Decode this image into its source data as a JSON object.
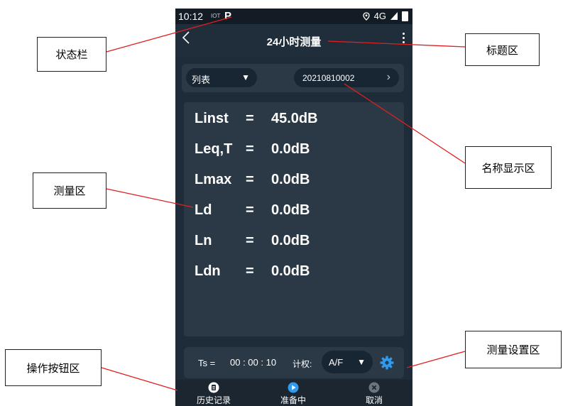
{
  "status_bar": {
    "time": "10:12",
    "iot": "IOT",
    "p": "P",
    "network": "4G"
  },
  "title_bar": {
    "back_icon": "chevron-left-icon",
    "title": "24小时测量",
    "more_icon": "more-vertical-icon"
  },
  "name_bar": {
    "list_label": "列表",
    "list_arrow": "▼",
    "record_name": "20210810002",
    "record_arrow": "›"
  },
  "measurements": [
    {
      "label": "Linst",
      "eq": "=",
      "value": "45.0dB"
    },
    {
      "label": "Leq,T",
      "eq": "=",
      "value": "0.0dB"
    },
    {
      "label": "Lmax",
      "eq": "=",
      "value": "0.0dB"
    },
    {
      "label": "Ld",
      "eq": "=",
      "value": "0.0dB"
    },
    {
      "label": "Ln",
      "eq": "=",
      "value": "0.0dB"
    },
    {
      "label": "Ldn",
      "eq": "=",
      "value": "0.0dB"
    }
  ],
  "op_bar": {
    "ts_label": "Ts =",
    "ts_value": "00 : 00 : 10",
    "weighting_label": "计权:",
    "weighting_value": "A/F",
    "weighting_arrow": "▼",
    "settings_icon": "gear-icon"
  },
  "bottom_nav": [
    {
      "label": "历史记录",
      "icon": "clipboard-icon"
    },
    {
      "label": "准备中",
      "icon": "play-icon"
    },
    {
      "label": "取消",
      "icon": "close-circle-icon"
    }
  ],
  "annotations": {
    "status_bar": "状态栏",
    "title_area": "标题区",
    "name_area": "名称显示区",
    "measure_area": "测量区",
    "settings_area": "测量设置区",
    "buttons_area": "操作按钮区"
  },
  "colors": {
    "background": "#1e2b38",
    "panel": "#2b3947",
    "pill": "#182532",
    "accent": "#2f9bf0",
    "annotation_line": "#e02020"
  }
}
